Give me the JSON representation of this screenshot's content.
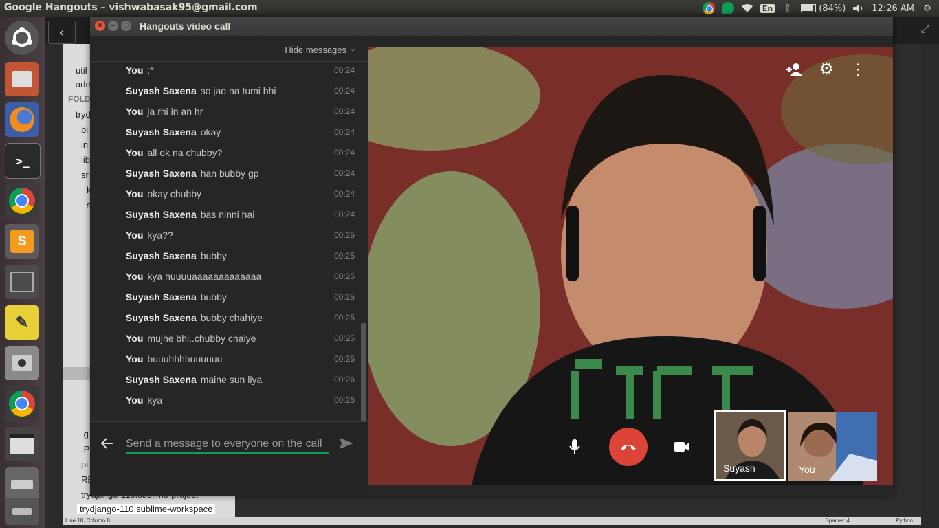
{
  "top_panel": {
    "title": "Google Hangouts – vishwabasak95@gmail.com",
    "keyboard": "En",
    "battery": "(84%)",
    "time": "12:26 AM"
  },
  "window": {
    "title": "Hangouts video call"
  },
  "chat": {
    "hide_messages": "Hide messages",
    "messages": [
      {
        "sender": "You",
        "text": ":*",
        "time": "00:24"
      },
      {
        "sender": "Suyash Saxena",
        "text": "so jao na tumi bhi",
        "time": "00:24"
      },
      {
        "sender": "You",
        "text": "ja rhi in an hr",
        "time": "00:24"
      },
      {
        "sender": "Suyash Saxena",
        "text": "okay",
        "time": "00:24"
      },
      {
        "sender": "You",
        "text": "all ok  na chubby?",
        "time": "00:24"
      },
      {
        "sender": "Suyash Saxena",
        "text": "han bubby gp",
        "time": "00:24"
      },
      {
        "sender": "You",
        "text": "okay chubby",
        "time": "00:24"
      },
      {
        "sender": "Suyash Saxena",
        "text": "bas ninni hai",
        "time": "00:24"
      },
      {
        "sender": "You",
        "text": "kya??",
        "time": "00:25"
      },
      {
        "sender": "Suyash Saxena",
        "text": "bubby",
        "time": "00:25"
      },
      {
        "sender": "You",
        "text": "kya huuuuaaaaaaaaaaaaa",
        "time": "00:25"
      },
      {
        "sender": "Suyash Saxena",
        "text": "bubby",
        "time": "00:25"
      },
      {
        "sender": "Suyash Saxena",
        "text": "bubby chahiye",
        "time": "00:25"
      },
      {
        "sender": "You",
        "text": "mujhe bhi..chubby chaiye",
        "time": "00:25"
      },
      {
        "sender": "You",
        "text": "buuuhhhhuuuuuu",
        "time": "00:25"
      },
      {
        "sender": "Suyash Saxena",
        "text": "maine sun liya",
        "time": "00:26"
      },
      {
        "sender": "You",
        "text": "kya",
        "time": "00:26"
      }
    ],
    "input_placeholder": "Send a message to everyone on the call"
  },
  "participants": [
    {
      "label": "Suyash"
    },
    {
      "label": "You"
    }
  ],
  "sidebar_bg": {
    "items": [
      "util",
      "adm",
      "FOLD",
      "tryd",
      "bi",
      "in",
      "lib",
      "sr",
      "k",
      "s",
      ".g",
      ".P",
      "pi",
      "RE",
      "trydjango-110.sublime-project",
      "trydjango-110.sublime-workspace"
    ],
    "status_left": "Line 18, Column 8",
    "status_spaces": "Spaces: 4",
    "status_lang": "Python"
  },
  "colors": {
    "accent_green": "#0f9d58",
    "end_call_red": "#db4437"
  }
}
